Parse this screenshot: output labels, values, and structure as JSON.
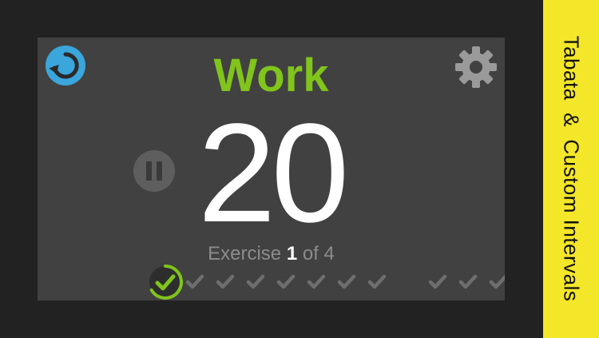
{
  "phase": {
    "label": "Work",
    "color": "#80c41c"
  },
  "timer": {
    "value": "20"
  },
  "exercise": {
    "prefix": "Exercise",
    "current": "1",
    "of_text": "of 4"
  },
  "controls": {
    "reset_icon": "reset-icon",
    "settings_icon": "gear-icon",
    "pause_icon": "pause-icon",
    "reset_color": "#3aa6dc"
  },
  "progress": {
    "current_index": 0,
    "total_visible": 11,
    "current_color": "#80c41c",
    "check_color": "#6e6e6e"
  },
  "banner": {
    "text": "Tabata  &  Custom Intervals",
    "color": "#f4e629"
  }
}
